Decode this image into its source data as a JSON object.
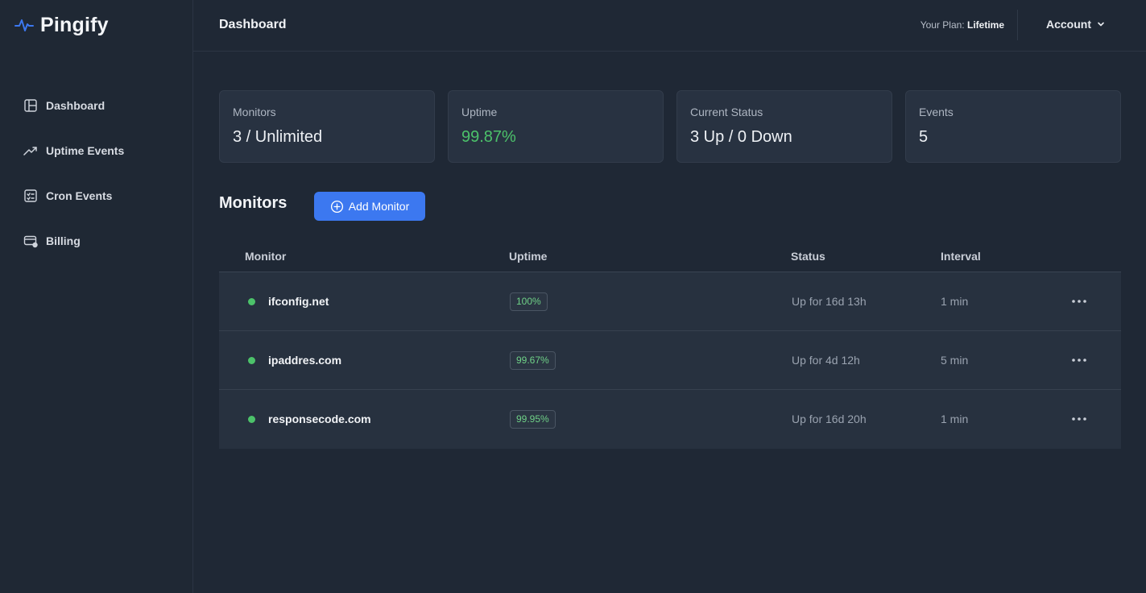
{
  "brand": {
    "name": "Pingify",
    "accent": "#3c78f0"
  },
  "sidebar": {
    "items": [
      {
        "label": "Dashboard",
        "icon": "layout-icon"
      },
      {
        "label": "Uptime Events",
        "icon": "trend-up-icon"
      },
      {
        "label": "Cron Events",
        "icon": "checklist-icon"
      },
      {
        "label": "Billing",
        "icon": "billing-card-icon"
      }
    ]
  },
  "header": {
    "title": "Dashboard",
    "plan_label": "Your Plan:",
    "plan_value": "Lifetime",
    "account_label": "Account"
  },
  "stats": [
    {
      "label": "Monitors",
      "value": "3 / Unlimited"
    },
    {
      "label": "Uptime",
      "value": "99.87%",
      "color": "#4cc26a"
    },
    {
      "label": "Current Status",
      "value": "3 Up / 0 Down"
    },
    {
      "label": "Events",
      "value": "5"
    }
  ],
  "monitors": {
    "title": "Monitors",
    "add_label": "Add Monitor",
    "columns": [
      "Monitor",
      "Uptime",
      "Status",
      "Interval"
    ],
    "rows": [
      {
        "name": "ifconfig.net",
        "uptime": "100%",
        "status": "Up for 16d 13h",
        "interval": "1 min"
      },
      {
        "name": "ipaddres.com",
        "uptime": "99.67%",
        "status": "Up for 4d 12h",
        "interval": "5 min"
      },
      {
        "name": "responsecode.com",
        "uptime": "99.95%",
        "status": "Up for 16d 20h",
        "interval": "1 min"
      }
    ]
  },
  "colors": {
    "status_up": "#4cc26a",
    "background": "#1f2835",
    "card": "#283241"
  }
}
